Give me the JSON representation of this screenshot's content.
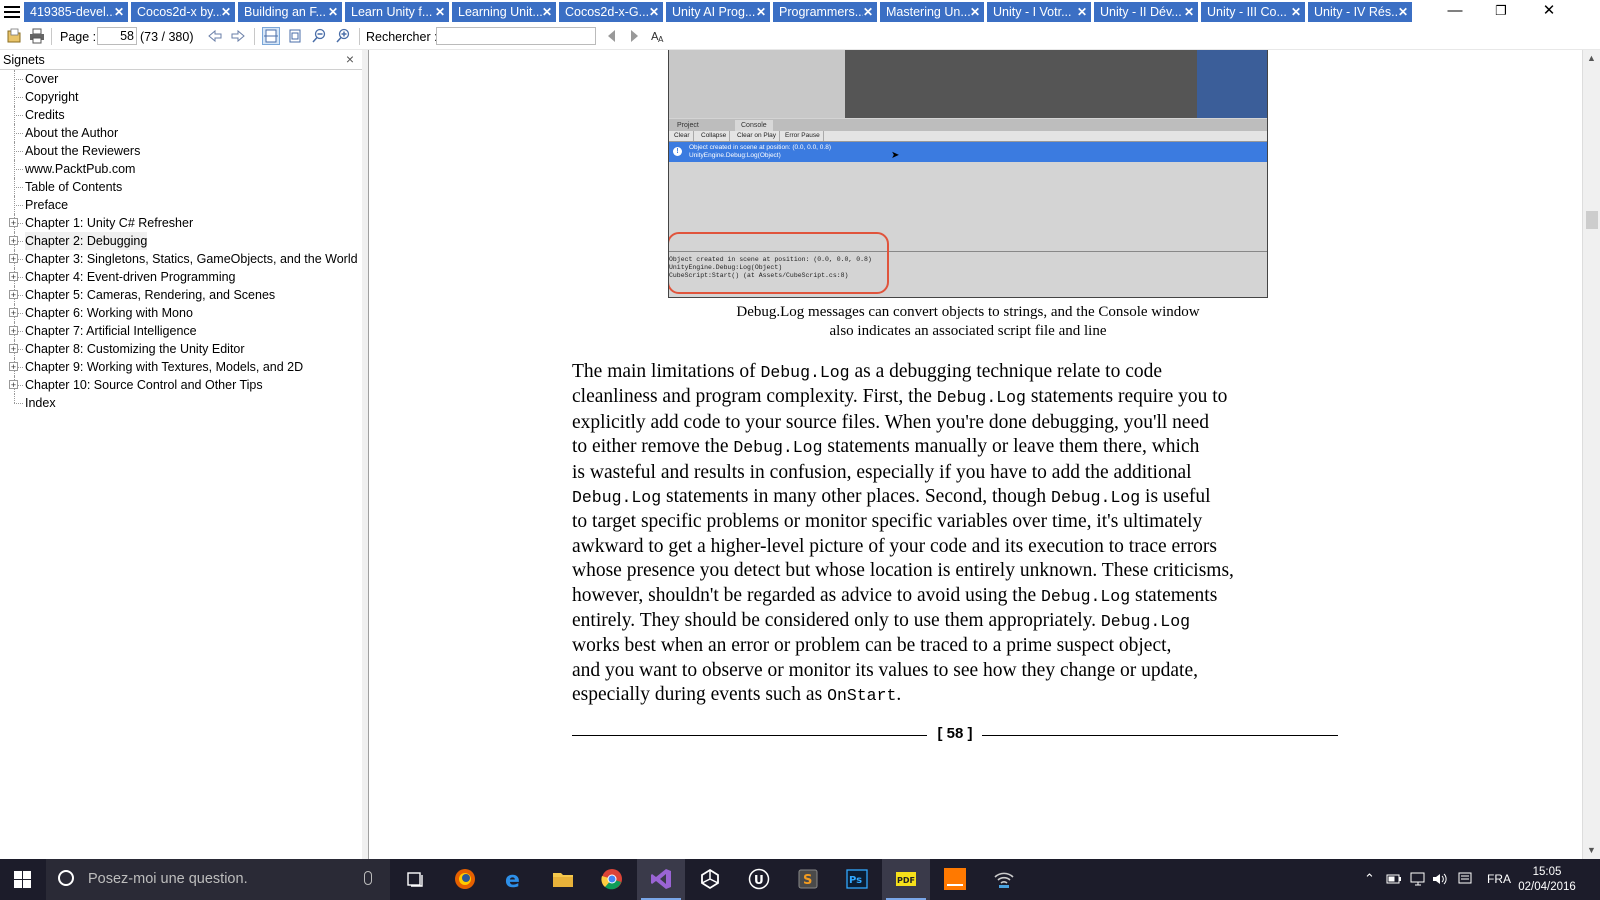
{
  "tabs": [
    {
      "label": "419385-devel..."
    },
    {
      "label": "Cocos2d-x by..."
    },
    {
      "label": "Building an F..."
    },
    {
      "label": "Learn Unity f..."
    },
    {
      "label": "Learning Unit..."
    },
    {
      "label": "Cocos2d-x-G..."
    },
    {
      "label": "Unity AI Prog..."
    },
    {
      "label": "Programmers..."
    },
    {
      "label": "Mastering  Un..."
    },
    {
      "label": "Unity - I Votr..."
    },
    {
      "label": "Unity - II Dév..."
    },
    {
      "label": "Unity - III Co..."
    },
    {
      "label": "Unity - IV Rés..."
    }
  ],
  "tab_close_glyph": "✕",
  "window_controls": {
    "minimize": "—",
    "restore": "❐",
    "close": "✕"
  },
  "toolbar": {
    "page_label": "Page :",
    "page_value": "58",
    "page_count": "(73 / 380)",
    "search_label": "Rechercher :"
  },
  "sidebar": {
    "title": "Signets",
    "close": "×",
    "items": [
      {
        "label": "Cover",
        "expandable": false
      },
      {
        "label": "Copyright",
        "expandable": false
      },
      {
        "label": "Credits",
        "expandable": false
      },
      {
        "label": "About the Author",
        "expandable": false
      },
      {
        "label": "About the Reviewers",
        "expandable": false
      },
      {
        "label": "www.PacktPub.com",
        "expandable": false
      },
      {
        "label": "Table of Contents",
        "expandable": false
      },
      {
        "label": "Preface",
        "expandable": false
      },
      {
        "label": "Chapter 1: Unity C# Refresher",
        "expandable": true
      },
      {
        "label": "Chapter 2: Debugging",
        "expandable": true,
        "selected": true
      },
      {
        "label": "Chapter 3: Singletons, Statics, GameObjects, and the World",
        "expandable": true
      },
      {
        "label": "Chapter 4: Event-driven Programming",
        "expandable": true
      },
      {
        "label": "Chapter 5: Cameras, Rendering, and Scenes",
        "expandable": true
      },
      {
        "label": "Chapter 6: Working with Mono",
        "expandable": true
      },
      {
        "label": "Chapter 7: Artificial Intelligence",
        "expandable": true
      },
      {
        "label": "Chapter 8: Customizing the Unity Editor",
        "expandable": true
      },
      {
        "label": "Chapter 9: Working with Textures, Models, and 2D",
        "expandable": true
      },
      {
        "label": "Chapter 10: Source Control and Other Tips",
        "expandable": true
      },
      {
        "label": "Index",
        "expandable": false
      }
    ]
  },
  "figure": {
    "tab_project": "Project",
    "tab_console": "Console",
    "buttons": [
      "Clear",
      "Collapse",
      "Clear on Play",
      "Error Pause"
    ],
    "log_line1": "Object created in scene at position: (0.0, 0.0, 0.8)",
    "log_line2": "UnityEngine.Debug:Log(Object)",
    "detail_line1": "Object created in scene at position: (0.0, 0.0, 0.8)",
    "detail_line2": "UnityEngine.Debug:Log(Object)",
    "detail_line3": "CubeScript:Start() (at Assets/CubeScript.cs:8)"
  },
  "caption": {
    "line1": "Debug.Log messages can convert objects to strings, and the Console window",
    "line2": "also indicates an associated script file and line"
  },
  "body_lines": [
    [
      {
        "t": "The main limitations of "
      },
      {
        "c": "Debug.Log"
      },
      {
        "t": " as a debugging technique relate to code"
      }
    ],
    [
      {
        "t": "cleanliness and program complexity. First, the "
      },
      {
        "c": "Debug.Log"
      },
      {
        "t": " statements require you to"
      }
    ],
    [
      {
        "t": "explicitly add code to your source files. When you're done debugging, you'll need"
      }
    ],
    [
      {
        "t": "to either remove the "
      },
      {
        "c": "Debug.Log"
      },
      {
        "t": " statements manually or leave them there, which"
      }
    ],
    [
      {
        "t": "is wasteful and results in confusion, especially if you have to add the additional"
      }
    ],
    [
      {
        "c": "Debug.Log"
      },
      {
        "t": " statements in many other places. Second, though "
      },
      {
        "c": "Debug.Log"
      },
      {
        "t": " is useful"
      }
    ],
    [
      {
        "t": "to target specific problems or monitor specific variables over time, it's ultimately"
      }
    ],
    [
      {
        "t": "awkward to get a higher-level picture of your code and its execution to trace errors"
      }
    ],
    [
      {
        "t": "whose presence you detect but whose location is entirely unknown. These criticisms,"
      }
    ],
    [
      {
        "t": "however, shouldn't be regarded as advice to avoid using the "
      },
      {
        "c": "Debug.Log"
      },
      {
        "t": " statements"
      }
    ],
    [
      {
        "t": "entirely. They should be considered only to use them appropriately. "
      },
      {
        "c": "Debug.Log"
      }
    ],
    [
      {
        "t": "works best when an error or problem can be traced to a prime suspect object,"
      }
    ],
    [
      {
        "t": "and you want to observe or monitor its values to see how they change or update,"
      }
    ],
    [
      {
        "t": "especially during events such as "
      },
      {
        "c": "OnStart"
      },
      {
        "t": "."
      }
    ]
  ],
  "page_number": "[ 58 ]",
  "taskbar": {
    "search_placeholder": "Posez-moi une question.",
    "apps": [
      {
        "name": "task-view"
      },
      {
        "name": "firefox"
      },
      {
        "name": "edge"
      },
      {
        "name": "file-explorer"
      },
      {
        "name": "chrome"
      },
      {
        "name": "visual-studio"
      },
      {
        "name": "unity"
      },
      {
        "name": "unreal-engine"
      },
      {
        "name": "sublime-text"
      },
      {
        "name": "photoshop"
      },
      {
        "name": "pdf-reader"
      },
      {
        "name": "orange"
      },
      {
        "name": "wifi-app"
      }
    ],
    "language": "FRA",
    "time": "15:05",
    "date": "02/04/2016"
  },
  "colors": {
    "tab_bg": "#3b6fc4",
    "taskbar_bg": "#1c1c2a",
    "highlight_ring": "#e0543c",
    "console_selection": "#3b7be0"
  }
}
